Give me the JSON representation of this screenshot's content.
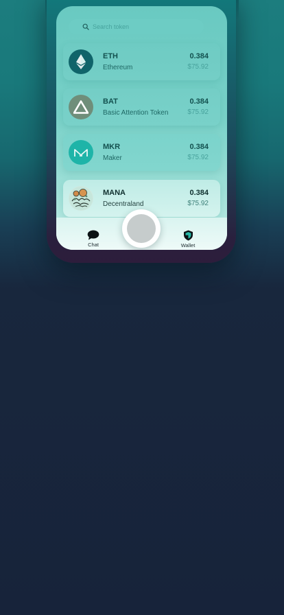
{
  "search": {
    "placeholder": "Search token"
  },
  "tokens": [
    {
      "symbol": "ETH",
      "name": "Ethereum",
      "amount": "0.384",
      "value": "$75.92",
      "icon": "ethereum-icon"
    },
    {
      "symbol": "BAT",
      "name": "Basic Attention Token",
      "amount": "0.384",
      "value": "$75.92",
      "icon": "bat-icon"
    },
    {
      "symbol": "MKR",
      "name": "Maker",
      "amount": "0.384",
      "value": "$75.92",
      "icon": "maker-icon"
    },
    {
      "symbol": "MANA",
      "name": "Decentraland",
      "amount": "0.384",
      "value": "$75.92",
      "icon": "decentraland-icon"
    }
  ],
  "nav": {
    "chat_label": "Chat",
    "wallet_label": "Wallet",
    "chat_icon": "chat-bubble-icon",
    "wallet_icon": "shield-icon"
  },
  "colors": {
    "accent": "#0c6c6a",
    "card": "#73cdc5",
    "eth": "#10646a",
    "bat": "#6f8e7a",
    "mkr": "#1eb4a8"
  }
}
